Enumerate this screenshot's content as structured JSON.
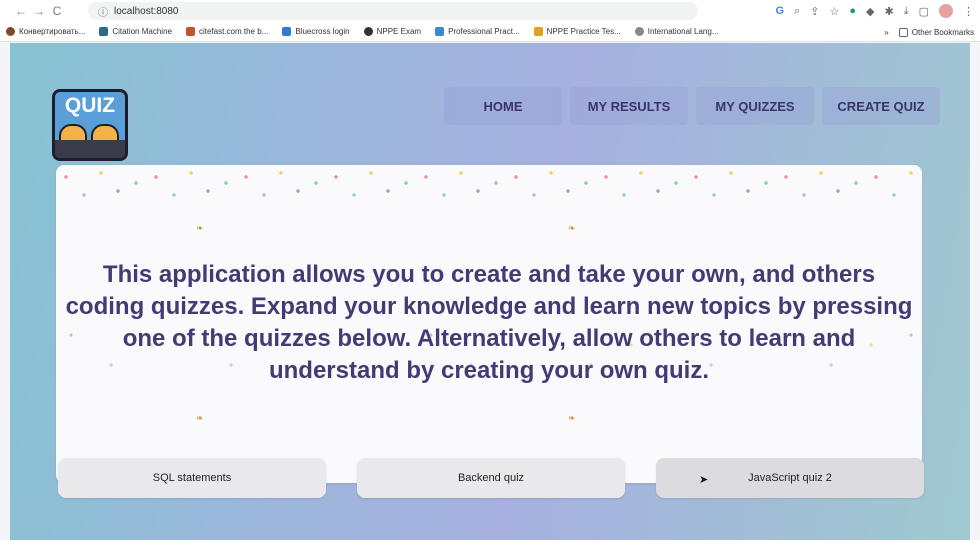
{
  "browser": {
    "url": "localhost:8080",
    "bookmarks": [
      "Конвертировать...",
      "Citation Machine",
      "citefast.com the b...",
      "Bluecross login",
      "NPPE Exam",
      "Professional Pract...",
      "NPPE Practice Tes...",
      "International Lang..."
    ],
    "more_label": "»",
    "other_bookmarks": "Other Bookmarks"
  },
  "app": {
    "logo_text": "QUIZ",
    "nav": {
      "home": "HOME",
      "results": "MY RESULTS",
      "quizzes": "MY QUIZZES",
      "create": "CREATE QUIZ"
    },
    "hero_text": "This application allows you to create and take your own, and others coding quizzes. Expand your knowledge and learn new topics by pressing one of the quizzes below. Alternatively, allow others to learn and understand by creating your own quiz.",
    "quizzes": [
      "SQL statements",
      "Backend quiz",
      "JavaScript quiz 2"
    ]
  },
  "colors": {
    "accent_text": "#443a76",
    "nav_text": "#3b3566"
  }
}
